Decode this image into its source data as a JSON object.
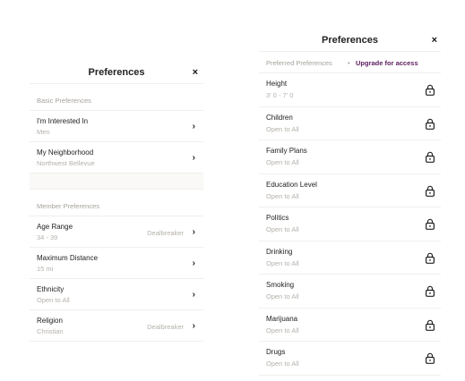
{
  "left": {
    "title": "Preferences",
    "close": "×",
    "basic_section": "Basic Preferences",
    "member_section": "Member Preferences",
    "basic_items": [
      {
        "name": "I'm Interested In",
        "value": "Men",
        "tag": "",
        "chevron": "›"
      },
      {
        "name": "My Neighborhood",
        "value": "Northwest Bellevue",
        "tag": "",
        "chevron": "›"
      }
    ],
    "member_items": [
      {
        "name": "Age Range",
        "value": "34 - 39",
        "tag": "Dealbreaker",
        "chevron": "›"
      },
      {
        "name": "Maximum Distance",
        "value": "15 mi",
        "tag": "",
        "chevron": "›"
      },
      {
        "name": "Ethnicity",
        "value": "Open to All",
        "tag": "",
        "chevron": "›"
      },
      {
        "name": "Religion",
        "value": "Christian",
        "tag": "Dealbreaker",
        "chevron": "›"
      }
    ]
  },
  "right": {
    "title": "Preferences",
    "close": "×",
    "subheader": "Preferred Preferences",
    "separator": "•",
    "upgrade": "Upgrade for access",
    "items": [
      {
        "name": "Height",
        "value": "3' 0 - 7' 0"
      },
      {
        "name": "Children",
        "value": "Open to All"
      },
      {
        "name": "Family Plans",
        "value": "Open to All"
      },
      {
        "name": "Education Level",
        "value": "Open to All"
      },
      {
        "name": "Politics",
        "value": "Open to All"
      },
      {
        "name": "Drinking",
        "value": "Open to All"
      },
      {
        "name": "Smoking",
        "value": "Open to All"
      },
      {
        "name": "Marijuana",
        "value": "Open to All"
      },
      {
        "name": "Drugs",
        "value": "Open to All"
      }
    ]
  },
  "colors": {
    "upgrade_accent": "#5b1d5e",
    "muted_text": "#b5b1ab"
  }
}
